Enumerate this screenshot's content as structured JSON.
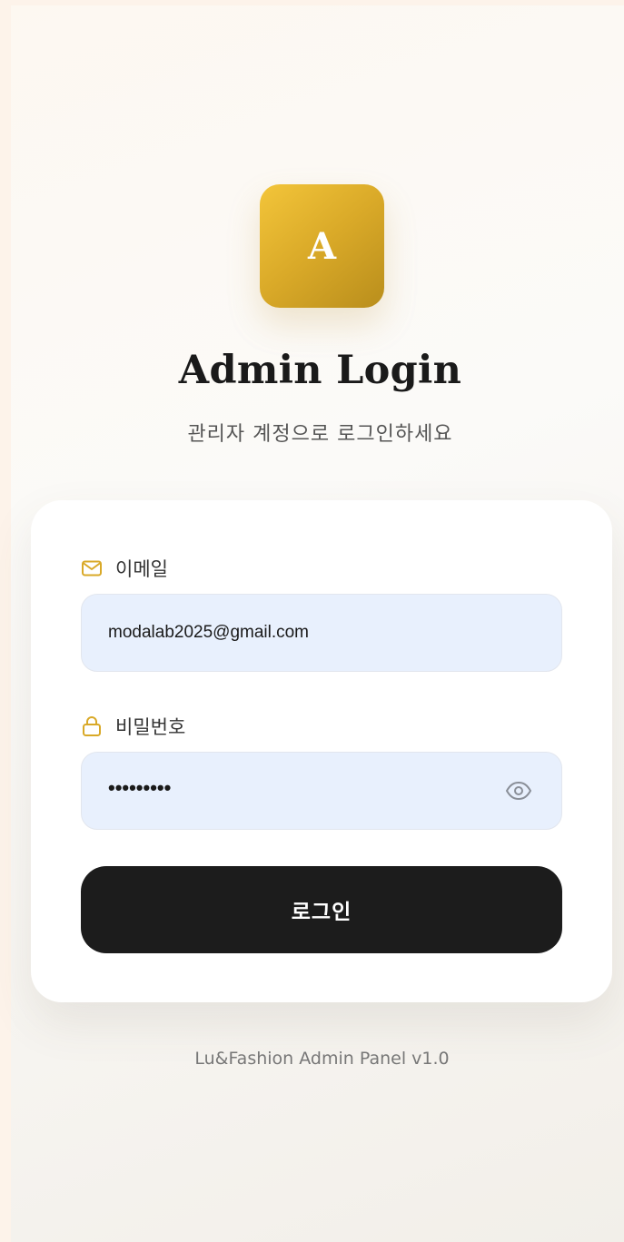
{
  "logo": {
    "letter": "A"
  },
  "header": {
    "title": "Admin Login",
    "subtitle": "관리자 계정으로 로그인하세요"
  },
  "form": {
    "email": {
      "label": "이메일",
      "value": "modalab2025@gmail.com",
      "icon": "mail-icon"
    },
    "password": {
      "label": "비밀번호",
      "value_masked": "•••••••••",
      "icon": "lock-icon",
      "toggle_icon": "eye-icon"
    },
    "submit_label": "로그인"
  },
  "footer": {
    "text": "Lu&Fashion Admin Panel v1.0"
  },
  "colors": {
    "accent": "#d9a928",
    "button": "#1c1c1c",
    "input_bg": "#e8f0fd"
  }
}
